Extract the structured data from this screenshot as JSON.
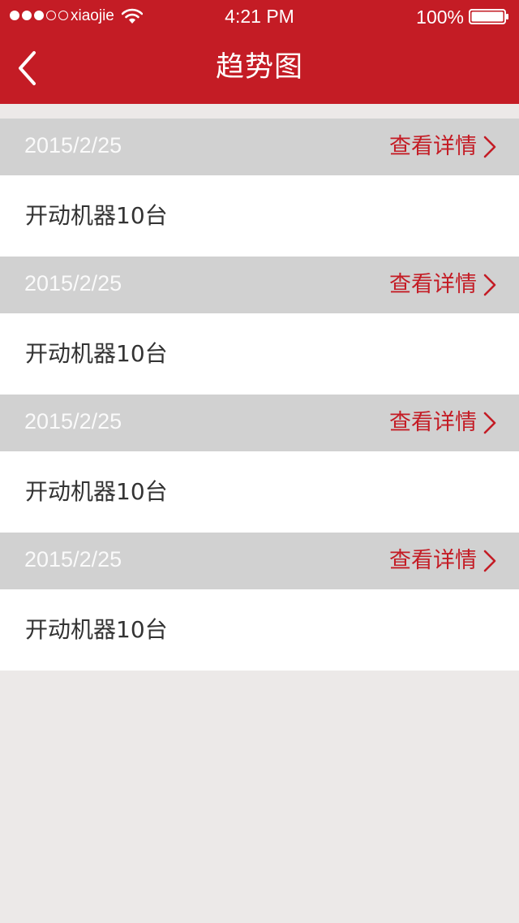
{
  "status_bar": {
    "carrier": "xiaojie",
    "time": "4:21 PM",
    "battery": "100%",
    "battery_level": 1.0,
    "signal_strength_filled": 3,
    "signal_strength_total": 5
  },
  "nav": {
    "title": "趋势图",
    "back_icon": "chevron-left-icon"
  },
  "records": [
    {
      "date": "2015/2/25",
      "detail_label": "查看详情",
      "content": "开动机器10台"
    },
    {
      "date": "2015/2/25",
      "detail_label": "查看详情",
      "content": "开动机器10台"
    },
    {
      "date": "2015/2/25",
      "detail_label": "查看详情",
      "content": "开动机器10台"
    },
    {
      "date": "2015/2/25",
      "detail_label": "查看详情",
      "content": "开动机器10台"
    }
  ],
  "colors": {
    "brand_red": "#c41c25",
    "header_row_gray": "#d1d1d1",
    "page_background": "#ece9e8"
  }
}
